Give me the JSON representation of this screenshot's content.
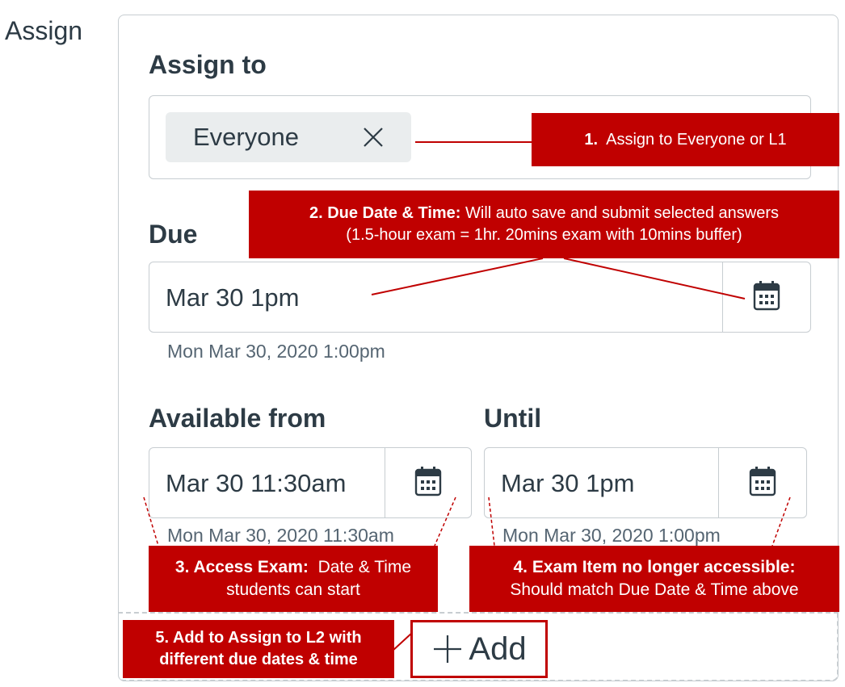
{
  "section_label": "Assign",
  "assign_to": {
    "heading": "Assign to",
    "chip_label": "Everyone",
    "chip_remove_icon": "close-icon"
  },
  "due": {
    "heading": "Due",
    "value": "Mar 30 1pm",
    "hint": "Mon Mar 30, 2020 1:00pm",
    "icon": "calendar-icon"
  },
  "available_from": {
    "heading": "Available from",
    "value": "Mar 30 11:30am",
    "hint": "Mon Mar 30, 2020 11:30am",
    "icon": "calendar-icon"
  },
  "until": {
    "heading": "Until",
    "value": "Mar 30 1pm",
    "hint": "Mon Mar 30, 2020 1:00pm",
    "icon": "calendar-icon"
  },
  "add_button": {
    "label": "Add",
    "icon": "plus-icon"
  },
  "callouts": {
    "c1": {
      "bold": "1.",
      "text": "Assign to Everyone or L1"
    },
    "c2": {
      "bold": "2. Due Date & Time:",
      "text": "Will auto save and submit selected answers",
      "line2": "(1.5-hour exam = 1hr. 20mins exam with 10mins buffer)"
    },
    "c3": {
      "bold": "3.  Access Exam:",
      "text": "Date & Time",
      "line2": "students can start"
    },
    "c4": {
      "bold": "4.  Exam Item no longer accessible:",
      "line2": "Should match Due Date & Time above"
    },
    "c5": {
      "line1": "5. Add to Assign to L2 with",
      "line2": "different due dates & time"
    }
  },
  "colors": {
    "callout": "#c00000",
    "text": "#2d3b45",
    "border": "#c7cdd1",
    "chip": "#eaedee"
  }
}
